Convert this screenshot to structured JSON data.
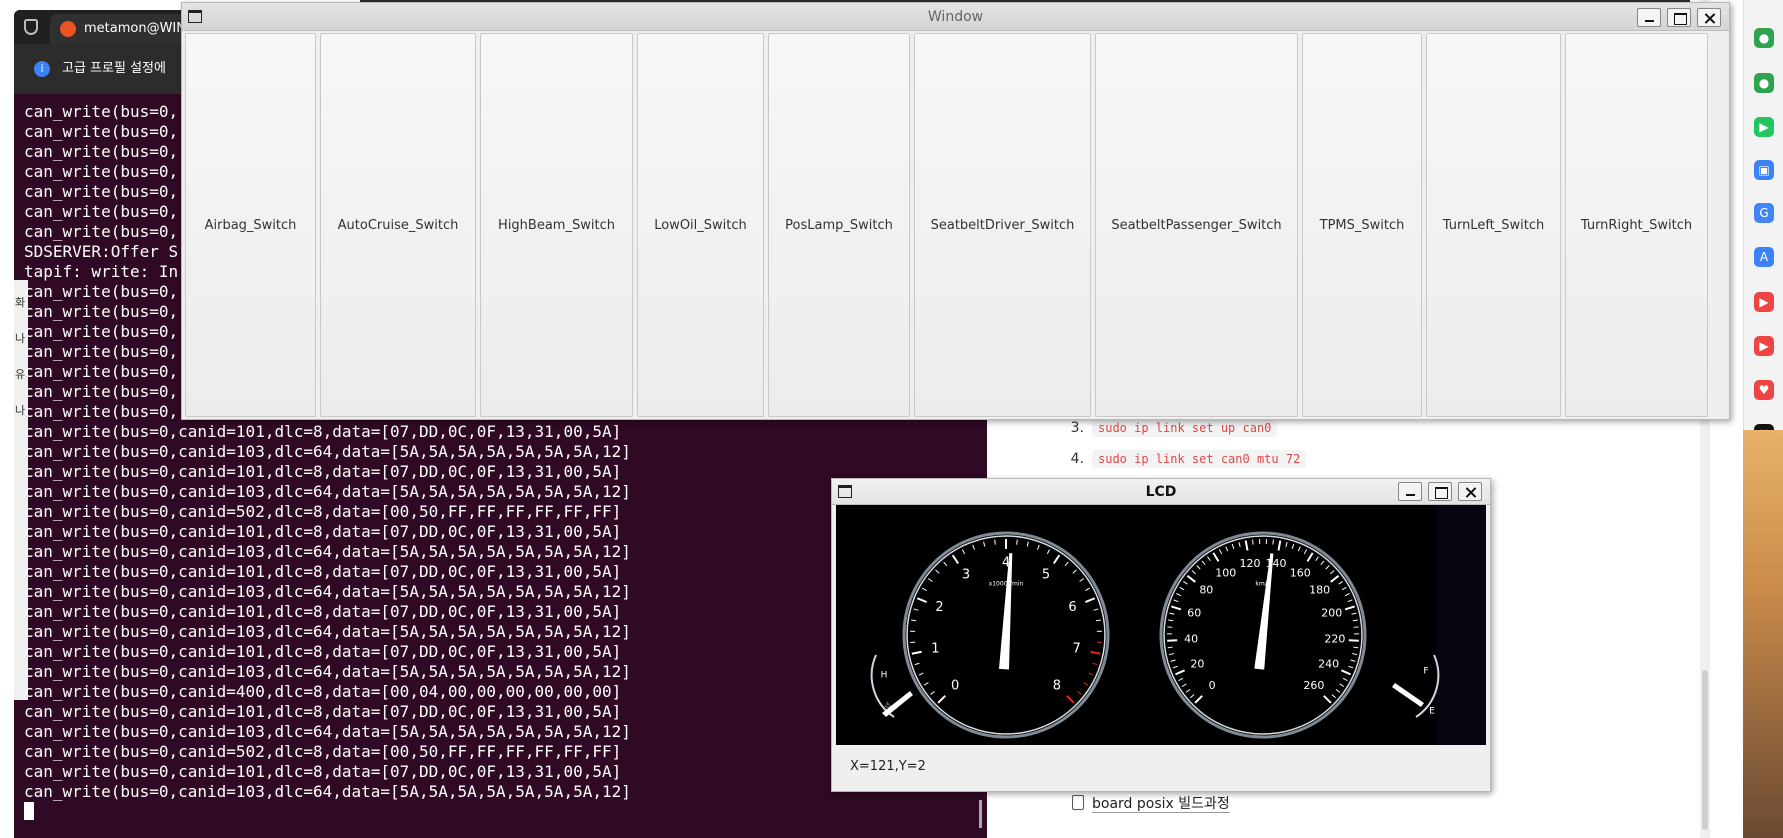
{
  "terminal": {
    "tab_title": "metamon@WIN-",
    "info_text": "고급 프로필 설정에",
    "lines": [
      "can_write(bus=0,",
      "can_write(bus=0,",
      "can_write(bus=0,",
      "can_write(bus=0,",
      "can_write(bus=0,",
      "can_write(bus=0,",
      "can_write(bus=0,",
      "SDSERVER:Offer S",
      "tapif: write: In",
      "can_write(bus=0,",
      "can_write(bus=0,",
      "can_write(bus=0,",
      "can_write(bus=0,",
      "can_write(bus=0,",
      "can_write(bus=0,",
      "can_write(bus=0,",
      "can_write(bus=0,canid=101,dlc=8,data=[07,DD,0C,0F,13,31,00,5A]",
      "can_write(bus=0,canid=103,dlc=64,data=[5A,5A,5A,5A,5A,5A,5A,12]",
      "can_write(bus=0,canid=101,dlc=8,data=[07,DD,0C,0F,13,31,00,5A]",
      "can_write(bus=0,canid=103,dlc=64,data=[5A,5A,5A,5A,5A,5A,5A,12]",
      "can_write(bus=0,canid=502,dlc=8,data=[00,50,FF,FF,FF,FF,FF,FF]",
      "can_write(bus=0,canid=101,dlc=8,data=[07,DD,0C,0F,13,31,00,5A]",
      "can_write(bus=0,canid=103,dlc=64,data=[5A,5A,5A,5A,5A,5A,5A,12]",
      "can_write(bus=0,canid=101,dlc=8,data=[07,DD,0C,0F,13,31,00,5A]",
      "can_write(bus=0,canid=103,dlc=64,data=[5A,5A,5A,5A,5A,5A,5A,12]",
      "can_write(bus=0,canid=101,dlc=8,data=[07,DD,0C,0F,13,31,00,5A]",
      "can_write(bus=0,canid=103,dlc=64,data=[5A,5A,5A,5A,5A,5A,5A,12]",
      "can_write(bus=0,canid=101,dlc=8,data=[07,DD,0C,0F,13,31,00,5A]",
      "can_write(bus=0,canid=103,dlc=64,data=[5A,5A,5A,5A,5A,5A,5A,12]",
      "can_write(bus=0,canid=400,dlc=8,data=[00,04,00,00,00,00,00,00]",
      "can_write(bus=0,canid=101,dlc=8,data=[07,DD,0C,0F,13,31,00,5A]",
      "can_write(bus=0,canid=103,dlc=64,data=[5A,5A,5A,5A,5A,5A,5A,12]",
      "can_write(bus=0,canid=502,dlc=8,data=[00,50,FF,FF,FF,FF,FF,FF]",
      "can_write(bus=0,canid=101,dlc=8,data=[07,DD,0C,0F,13,31,00,5A]",
      "can_write(bus=0,canid=103,dlc=64,data=[5A,5A,5A,5A,5A,5A,5A,12]"
    ],
    "side_labels": [
      "화",
      "나",
      "유",
      "나"
    ]
  },
  "switch_window": {
    "title": "Window",
    "buttons": [
      "Airbag_Switch",
      "AutoCruise_Switch",
      "HighBeam_Switch",
      "LowOil_Switch",
      "PosLamp_Switch",
      "SeatbeltDriver_Switch",
      "SeatbeltPassenger_Switch",
      "TPMS_Switch",
      "TurnLeft_Switch",
      "TurnRight_Switch"
    ]
  },
  "lcd_window": {
    "title": "LCD",
    "status": "X=121,Y=2",
    "tach": {
      "ticks": [
        "0",
        "1",
        "2",
        "3",
        "4",
        "5",
        "6",
        "7",
        "8"
      ],
      "unit": "x1000r/min",
      "value": 4.1
    },
    "speedo": {
      "ticks": [
        "0",
        "20",
        "40",
        "60",
        "80",
        "100",
        "120",
        "140",
        "160",
        "180",
        "200",
        "220",
        "240",
        "260"
      ],
      "unit": "km/h",
      "value": 136
    },
    "temp_gauge": {
      "high": "H"
    },
    "fuel_gauge": {
      "full": "F",
      "empty": "E"
    }
  },
  "document": {
    "items": [
      {
        "num": "3.",
        "code": "sudo ip link set up can0"
      },
      {
        "num": "4.",
        "code": "sudo ip link set can0 mtu 72"
      }
    ],
    "link": "board posix 빌드과정"
  },
  "colors": {
    "terminal_bg": "#300a24",
    "code_red": "#e04848",
    "ubuntu_orange": "#e95420"
  }
}
